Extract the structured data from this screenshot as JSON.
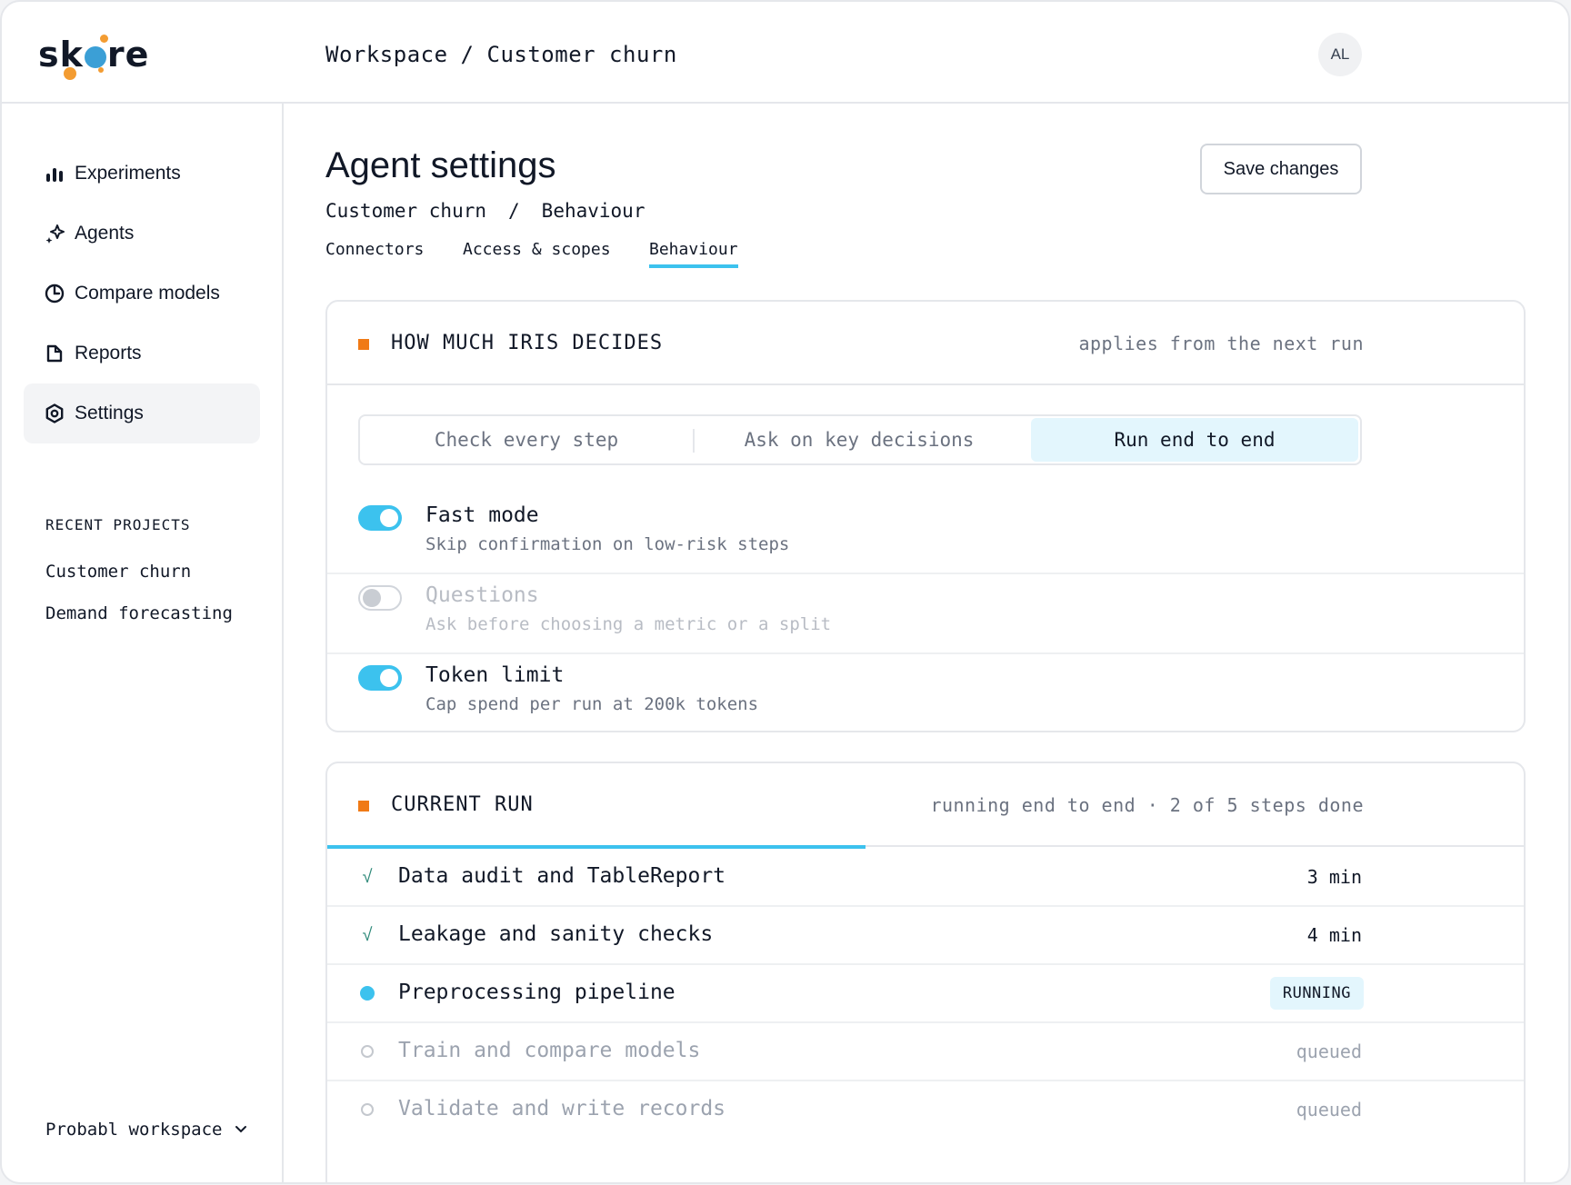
{
  "brand": {
    "name": "skore"
  },
  "topbar": {
    "breadcrumb": [
      "Workspace",
      "Customer churn"
    ],
    "separator": "/",
    "avatar_initials": "AL"
  },
  "sidebar": {
    "items": [
      {
        "label": "Experiments",
        "icon": "bar-chart-icon",
        "active": false
      },
      {
        "label": "Agents",
        "icon": "sparkle-icon",
        "active": false
      },
      {
        "label": "Compare models",
        "icon": "pie-chart-icon",
        "active": false
      },
      {
        "label": "Reports",
        "icon": "report-icon",
        "active": false
      },
      {
        "label": "Settings",
        "icon": "gear-icon",
        "active": true
      }
    ],
    "recent_title": "RECENT PROJECTS",
    "recent_projects": [
      "Customer churn",
      "Demand forecasting"
    ],
    "workspace_label": "Probabl workspace"
  },
  "main": {
    "title": "Agent settings",
    "breadcrumb": [
      "Customer churn",
      "Behaviour"
    ],
    "separator": "/",
    "save_label": "Save changes",
    "tabs": [
      {
        "label": "Connectors",
        "active": false
      },
      {
        "label": "Access & scopes",
        "active": false
      },
      {
        "label": "Behaviour",
        "active": true
      }
    ]
  },
  "decides": {
    "title": "HOW MUCH IRIS DECIDES",
    "meta": "applies from the next run",
    "modes": [
      {
        "label": "Check every step",
        "active": false
      },
      {
        "label": "Ask on key decisions",
        "active": false
      },
      {
        "label": "Run end to end",
        "active": true
      }
    ],
    "options": [
      {
        "title": "Fast mode",
        "desc": "Skip confirmation on low-risk steps",
        "enabled": true
      },
      {
        "title": "Questions",
        "desc": "Ask before choosing a metric or a split",
        "enabled": false
      },
      {
        "title": "Token limit",
        "desc": "Cap spend per run at 200k tokens",
        "enabled": true
      }
    ]
  },
  "run": {
    "title": "CURRENT RUN",
    "meta": "running end to end · 2 of 5 steps done",
    "progress_fraction": 0.45,
    "steps": [
      {
        "label": "Data audit and TableReport",
        "status": "done",
        "meta": "3 min"
      },
      {
        "label": "Leakage and sanity checks",
        "status": "done",
        "meta": "4 min"
      },
      {
        "label": "Preprocessing pipeline",
        "status": "running",
        "meta": "RUNNING"
      },
      {
        "label": "Train and compare models",
        "status": "queued",
        "meta": "queued"
      },
      {
        "label": "Validate and write records",
        "status": "queued",
        "meta": "queued"
      }
    ]
  },
  "colors": {
    "accent": "#3cc2ee",
    "section_marker": "#f07a16",
    "done_check": "#2f8a7a",
    "logo_blue": "#3b9fd6",
    "logo_orange": "#f39c32"
  }
}
